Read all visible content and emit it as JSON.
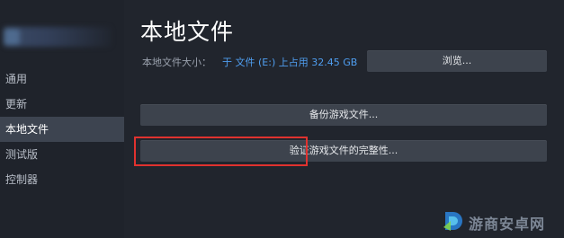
{
  "sidebar": {
    "items": [
      {
        "label": "通用"
      },
      {
        "label": "更新"
      },
      {
        "label": "本地文件"
      },
      {
        "label": "测试版"
      },
      {
        "label": "控制器"
      }
    ],
    "active_index": 2
  },
  "main": {
    "title": "本地文件",
    "size_label": "本地文件大小：",
    "size_value": "于 文件 (E:) 上占用 32.45 GB",
    "browse_label": "浏览...",
    "backup_label": "备份游戏文件...",
    "verify_label": "验证游戏文件的完整性..."
  },
  "watermark": {
    "text": "游商安卓网"
  },
  "colors": {
    "highlight": "#e0322f",
    "link": "#4f9ef0",
    "active_nav": "#3d4450"
  }
}
